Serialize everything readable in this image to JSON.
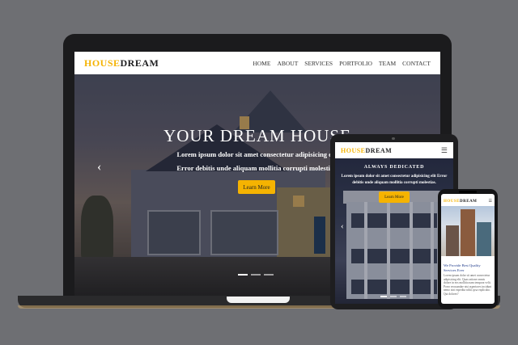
{
  "laptop": {
    "logo_a": "HOUSE",
    "logo_b": "DREAM",
    "menu": [
      "HOME",
      "ABOUT",
      "SERVICES",
      "PORTFOLIO",
      "TEAM",
      "CONTACT"
    ],
    "hero_title": "YOUR DREAM HOUSE",
    "hero_line1": "Lorem ipsum dolor sit amet consectetur adipisicing elit",
    "hero_line2": "Error debitis unde aliquam mollitia corrupti molestias.",
    "cta": "Learn More",
    "prev_arrow": "‹",
    "slides": 3,
    "active_slide": 0
  },
  "tablet": {
    "logo_a": "HOUSE",
    "logo_b": "DREAM",
    "menu_icon": "☰",
    "kicker": "ALWAYS DEDICATED",
    "sub": "Lorem ipsum dolor sit amet consectetur adipisicing elit Error debitis unde aliquam mollitia corrupti molestias.",
    "cta": "Learn More",
    "prev_arrow": "‹"
  },
  "phone": {
    "logo_a": "HOUSE",
    "logo_b": "DREAM",
    "menu_icon": "☰",
    "heading": "We Provide Best Quality Services Ever",
    "body": "Lorem ipsum dolor sit amet consectetur adipisicing elit. Quas ratione omnis dolore in eos mollitia nam tempora velit. Porro recusandae nisi asperiores incidunt nemo sint expedita nihil, ipsa explicabo. Qui dolores?"
  },
  "colors": {
    "accent": "#f5b301",
    "background": "#6e6f73",
    "device": "#1b1b1d"
  }
}
